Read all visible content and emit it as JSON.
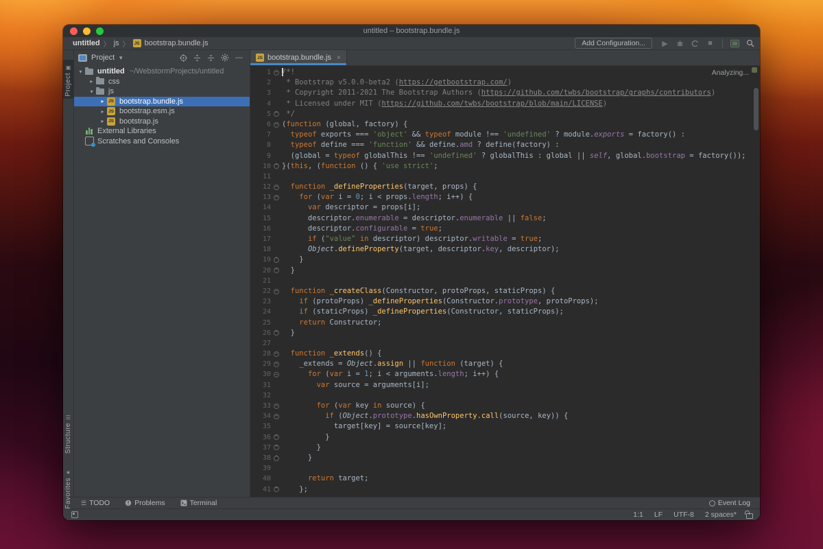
{
  "titlebar": {
    "title": "untitled – bootstrap.bundle.js"
  },
  "breadcrumb": {
    "items": [
      "untitled",
      "js",
      "bootstrap.bundle.js"
    ],
    "separator": "〉"
  },
  "toolbar": {
    "add_config_label": "Add Configuration...",
    "icons": [
      "run-icon",
      "debug-icon",
      "run-with-coverage-icon",
      "stop-icon",
      "terminal-window-icon",
      "search-everywhere-icon"
    ]
  },
  "stripe": {
    "project": "Project",
    "structure": "Structure",
    "favorites": "Favorites"
  },
  "project": {
    "header": "Project",
    "tree": [
      {
        "indent": 0,
        "chev": "v",
        "type": "folder",
        "label": "untitled",
        "bold": true,
        "path": "~/WebstormProjects/untitled",
        "selected": false
      },
      {
        "indent": 1,
        "chev": ">",
        "type": "folder",
        "label": "css",
        "selected": false
      },
      {
        "indent": 1,
        "chev": "v",
        "type": "folder",
        "label": "js",
        "selected": false
      },
      {
        "indent": 2,
        "chev": ">",
        "type": "js",
        "label": "bootstrap.bundle.js",
        "selected": true
      },
      {
        "indent": 2,
        "chev": ">",
        "type": "js",
        "label": "bootstrap.esm.js",
        "selected": false
      },
      {
        "indent": 2,
        "chev": ">",
        "type": "js",
        "label": "bootstrap.js",
        "selected": false
      },
      {
        "indent": 0,
        "chev": "",
        "type": "lib",
        "label": "External Libraries",
        "selected": false
      },
      {
        "indent": 0,
        "chev": "",
        "type": "scratch",
        "label": "Scratches and Consoles",
        "selected": false
      }
    ]
  },
  "editor": {
    "tab": {
      "label": "bootstrap.bundle.js",
      "close": "×"
    },
    "analyzing": "Analyzing...",
    "colors": {
      "selection": "#3c6fb6",
      "tab_underline": "#4a88c7"
    },
    "code": {
      "lines": [
        {
          "num": 1,
          "fold": "s",
          "tokens": [
            [
              "c",
              "/*!"
            ]
          ]
        },
        {
          "num": 2,
          "fold": "",
          "tokens": [
            [
              "c",
              " * Bootstrap v5.0.0-beta2 ("
            ],
            [
              "l",
              "https://getbootstrap.com/"
            ],
            [
              "c",
              ")"
            ]
          ]
        },
        {
          "num": 3,
          "fold": "",
          "tokens": [
            [
              "c",
              " * Copyright 2011-2021 The Bootstrap Authors ("
            ],
            [
              "l",
              "https://github.com/twbs/bootstrap/graphs/contributors"
            ],
            [
              "c",
              ")"
            ]
          ]
        },
        {
          "num": 4,
          "fold": "",
          "tokens": [
            [
              "c",
              " * Licensed under MIT ("
            ],
            [
              "l",
              "https://github.com/twbs/bootstrap/blob/main/LICENSE"
            ],
            [
              "c",
              ")"
            ]
          ]
        },
        {
          "num": 5,
          "fold": "e",
          "tokens": [
            [
              "c",
              " */"
            ]
          ]
        },
        {
          "num": 6,
          "fold": "s",
          "tokens": [
            [
              "d",
              "("
            ],
            [
              "k",
              "function"
            ],
            [
              "d",
              " (global, factory) {"
            ]
          ]
        },
        {
          "num": 7,
          "fold": "",
          "tokens": [
            [
              "d",
              "  "
            ],
            [
              "k",
              "typeof"
            ],
            [
              "d",
              " exports === "
            ],
            [
              "s",
              "'object'"
            ],
            [
              "d",
              " && "
            ],
            [
              "k",
              "typeof"
            ],
            [
              "d",
              " module !== "
            ],
            [
              "s",
              "'undefined'"
            ],
            [
              "d",
              " ? module."
            ],
            [
              "fi",
              "exports"
            ],
            [
              "d",
              " = factory() :"
            ]
          ]
        },
        {
          "num": 8,
          "fold": "",
          "tokens": [
            [
              "d",
              "  "
            ],
            [
              "k",
              "typeof"
            ],
            [
              "d",
              " define === "
            ],
            [
              "s",
              "'function'"
            ],
            [
              "d",
              " && define."
            ],
            [
              "f",
              "amd"
            ],
            [
              "d",
              " ? define(factory) :"
            ]
          ]
        },
        {
          "num": 9,
          "fold": "",
          "tokens": [
            [
              "d",
              "  (global = "
            ],
            [
              "k",
              "typeof"
            ],
            [
              "d",
              " globalThis !== "
            ],
            [
              "s",
              "'undefined'"
            ],
            [
              "d",
              " ? globalThis : global || "
            ],
            [
              "fi",
              "self"
            ],
            [
              "d",
              ", global."
            ],
            [
              "f",
              "bootstrap"
            ],
            [
              "d",
              " = factory());"
            ]
          ]
        },
        {
          "num": 10,
          "fold": "e",
          "tokens": [
            [
              "d",
              "}("
            ],
            [
              "k",
              "this"
            ],
            [
              "d",
              ", ("
            ],
            [
              "k",
              "function"
            ],
            [
              "d",
              " () { "
            ],
            [
              "s",
              "'use strict'"
            ],
            [
              "d",
              ";"
            ]
          ]
        },
        {
          "num": 11,
          "fold": "",
          "tokens": []
        },
        {
          "num": 12,
          "fold": "s",
          "tokens": [
            [
              "d",
              "  "
            ],
            [
              "k",
              "function"
            ],
            [
              "d",
              " "
            ],
            [
              "m",
              "_defineProperties"
            ],
            [
              "d",
              "(target, props) {"
            ]
          ]
        },
        {
          "num": 13,
          "fold": "s",
          "tokens": [
            [
              "d",
              "    "
            ],
            [
              "k",
              "for"
            ],
            [
              "d",
              " ("
            ],
            [
              "k",
              "var"
            ],
            [
              "d",
              " i = "
            ],
            [
              "n",
              "0"
            ],
            [
              "d",
              "; i < props."
            ],
            [
              "f",
              "length"
            ],
            [
              "d",
              "; i++) {"
            ]
          ]
        },
        {
          "num": 14,
          "fold": "",
          "tokens": [
            [
              "d",
              "      "
            ],
            [
              "k",
              "var"
            ],
            [
              "d",
              " descriptor = props[i];"
            ]
          ]
        },
        {
          "num": 15,
          "fold": "",
          "tokens": [
            [
              "d",
              "      descriptor."
            ],
            [
              "f",
              "enumerable"
            ],
            [
              "d",
              " = descriptor."
            ],
            [
              "f",
              "enumerable"
            ],
            [
              "d",
              " || "
            ],
            [
              "k",
              "false"
            ],
            [
              "d",
              ";"
            ]
          ]
        },
        {
          "num": 16,
          "fold": "",
          "tokens": [
            [
              "d",
              "      descriptor."
            ],
            [
              "f",
              "configurable"
            ],
            [
              "d",
              " = "
            ],
            [
              "k",
              "true"
            ],
            [
              "d",
              ";"
            ]
          ]
        },
        {
          "num": 17,
          "fold": "",
          "tokens": [
            [
              "d",
              "      "
            ],
            [
              "k",
              "if"
            ],
            [
              "d",
              " ("
            ],
            [
              "s",
              "\"value\""
            ],
            [
              "d",
              " "
            ],
            [
              "k",
              "in"
            ],
            [
              "d",
              " descriptor) descriptor."
            ],
            [
              "f",
              "writable"
            ],
            [
              "d",
              " = "
            ],
            [
              "k",
              "true"
            ],
            [
              "d",
              ";"
            ]
          ]
        },
        {
          "num": 18,
          "fold": "",
          "tokens": [
            [
              "d",
              "      "
            ],
            [
              "o",
              "Object"
            ],
            [
              "d",
              "."
            ],
            [
              "m",
              "defineProperty"
            ],
            [
              "d",
              "(target, descriptor."
            ],
            [
              "f",
              "key"
            ],
            [
              "d",
              ", descriptor);"
            ]
          ]
        },
        {
          "num": 19,
          "fold": "e",
          "tokens": [
            [
              "d",
              "    }"
            ]
          ]
        },
        {
          "num": 20,
          "fold": "e",
          "tokens": [
            [
              "d",
              "  }"
            ]
          ]
        },
        {
          "num": 21,
          "fold": "",
          "tokens": []
        },
        {
          "num": 22,
          "fold": "s",
          "tokens": [
            [
              "d",
              "  "
            ],
            [
              "k",
              "function"
            ],
            [
              "d",
              " "
            ],
            [
              "m",
              "_createClass"
            ],
            [
              "d",
              "(Constructor, protoProps, staticProps) {"
            ]
          ]
        },
        {
          "num": 23,
          "fold": "",
          "tokens": [
            [
              "d",
              "    "
            ],
            [
              "k",
              "if"
            ],
            [
              "d",
              " (protoProps) "
            ],
            [
              "m",
              "_defineProperties"
            ],
            [
              "d",
              "(Constructor."
            ],
            [
              "f",
              "prototype"
            ],
            [
              "d",
              ", protoProps);"
            ]
          ]
        },
        {
          "num": 24,
          "fold": "",
          "tokens": [
            [
              "d",
              "    "
            ],
            [
              "k",
              "if"
            ],
            [
              "d",
              " (staticProps) "
            ],
            [
              "m",
              "_defineProperties"
            ],
            [
              "d",
              "(Constructor, staticProps);"
            ]
          ]
        },
        {
          "num": 25,
          "fold": "",
          "tokens": [
            [
              "d",
              "    "
            ],
            [
              "k",
              "return"
            ],
            [
              "d",
              " Constructor;"
            ]
          ]
        },
        {
          "num": 26,
          "fold": "e",
          "tokens": [
            [
              "d",
              "  }"
            ]
          ]
        },
        {
          "num": 27,
          "fold": "",
          "tokens": []
        },
        {
          "num": 28,
          "fold": "s",
          "tokens": [
            [
              "d",
              "  "
            ],
            [
              "k",
              "function"
            ],
            [
              "d",
              " "
            ],
            [
              "m",
              "_extends"
            ],
            [
              "d",
              "() {"
            ]
          ]
        },
        {
          "num": 29,
          "fold": "s",
          "tokens": [
            [
              "d",
              "    _extends = "
            ],
            [
              "o",
              "Object"
            ],
            [
              "d",
              "."
            ],
            [
              "m",
              "assign"
            ],
            [
              "d",
              " || "
            ],
            [
              "k",
              "function"
            ],
            [
              "d",
              " (target) {"
            ]
          ]
        },
        {
          "num": 30,
          "fold": "s",
          "tokens": [
            [
              "d",
              "      "
            ],
            [
              "k",
              "for"
            ],
            [
              "d",
              " ("
            ],
            [
              "k",
              "var"
            ],
            [
              "d",
              " i = "
            ],
            [
              "n",
              "1"
            ],
            [
              "d",
              "; i < arguments."
            ],
            [
              "f",
              "length"
            ],
            [
              "d",
              "; i++) {"
            ]
          ]
        },
        {
          "num": 31,
          "fold": "",
          "tokens": [
            [
              "d",
              "        "
            ],
            [
              "k",
              "var"
            ],
            [
              "d",
              " source = arguments[i];"
            ]
          ]
        },
        {
          "num": 32,
          "fold": "",
          "tokens": []
        },
        {
          "num": 33,
          "fold": "s",
          "tokens": [
            [
              "d",
              "        "
            ],
            [
              "k",
              "for"
            ],
            [
              "d",
              " ("
            ],
            [
              "k",
              "var"
            ],
            [
              "d",
              " key "
            ],
            [
              "k",
              "in"
            ],
            [
              "d",
              " source) {"
            ]
          ]
        },
        {
          "num": 34,
          "fold": "s",
          "tokens": [
            [
              "d",
              "          "
            ],
            [
              "k",
              "if"
            ],
            [
              "d",
              " ("
            ],
            [
              "o",
              "Object"
            ],
            [
              "d",
              "."
            ],
            [
              "f",
              "prototype"
            ],
            [
              "d",
              "."
            ],
            [
              "m",
              "hasOwnProperty"
            ],
            [
              "d",
              "."
            ],
            [
              "m",
              "call"
            ],
            [
              "d",
              "(source, key)) {"
            ]
          ]
        },
        {
          "num": 35,
          "fold": "",
          "tokens": [
            [
              "d",
              "            target[key] = source[key];"
            ]
          ]
        },
        {
          "num": 36,
          "fold": "e",
          "tokens": [
            [
              "d",
              "          }"
            ]
          ]
        },
        {
          "num": 37,
          "fold": "e",
          "tokens": [
            [
              "d",
              "        }"
            ]
          ]
        },
        {
          "num": 38,
          "fold": "e",
          "tokens": [
            [
              "d",
              "      }"
            ]
          ]
        },
        {
          "num": 39,
          "fold": "",
          "tokens": []
        },
        {
          "num": 40,
          "fold": "",
          "tokens": [
            [
              "d",
              "      "
            ],
            [
              "k",
              "return"
            ],
            [
              "d",
              " target;"
            ]
          ]
        },
        {
          "num": 41,
          "fold": "e",
          "tokens": [
            [
              "d",
              "    };"
            ]
          ]
        }
      ]
    }
  },
  "toolwindows": {
    "todo": "TODO",
    "problems": "Problems",
    "terminal": "Terminal",
    "event_log": "Event Log"
  },
  "statusbar": {
    "position": "1:1",
    "line_ending": "LF",
    "encoding": "UTF-8",
    "indent": "2 spaces*"
  }
}
